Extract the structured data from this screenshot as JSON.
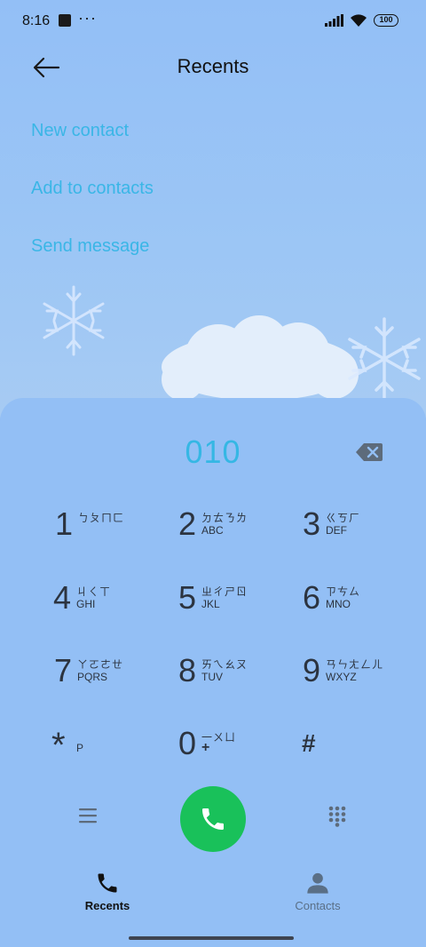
{
  "status_bar": {
    "time": "8:16",
    "dots": "···",
    "battery": "100"
  },
  "header": {
    "title": "Recents"
  },
  "actions": {
    "new_contact": "New contact",
    "add_to_contacts": "Add to contacts",
    "send_message": "Send message"
  },
  "dialer": {
    "number": "010",
    "keys": [
      {
        "digit": "1",
        "zhuyin": "ㄅㄆㄇㄈ",
        "letters": ""
      },
      {
        "digit": "2",
        "zhuyin": "ㄉㄊㄋㄌ",
        "letters": "ABC"
      },
      {
        "digit": "3",
        "zhuyin": "ㄍㄎㄏ",
        "letters": "DEF"
      },
      {
        "digit": "4",
        "zhuyin": "ㄐㄑㄒ",
        "letters": "GHI"
      },
      {
        "digit": "5",
        "zhuyin": "ㄓㄔㄕㄖ",
        "letters": "JKL"
      },
      {
        "digit": "6",
        "zhuyin": "ㄗㄘㄙ",
        "letters": "MNO"
      },
      {
        "digit": "7",
        "zhuyin": "ㄚㄛㄜㄝ",
        "letters": "PQRS"
      },
      {
        "digit": "8",
        "zhuyin": "ㄞㄟㄠㄡ",
        "letters": "TUV"
      },
      {
        "digit": "9",
        "zhuyin": "ㄢㄣㄤㄥㄦ",
        "letters": "WXYZ"
      },
      {
        "digit": "*",
        "zhuyin": "",
        "letters": "P"
      },
      {
        "digit": "0",
        "zhuyin": "一ㄨㄩ",
        "letters": "+"
      },
      {
        "digit": "#",
        "zhuyin": "",
        "letters": ""
      }
    ]
  },
  "colors": {
    "background": "#93bff5",
    "accent": "#35b7e4",
    "call": "#19c15a"
  },
  "nav": {
    "recents": "Recents",
    "contacts": "Contacts"
  }
}
